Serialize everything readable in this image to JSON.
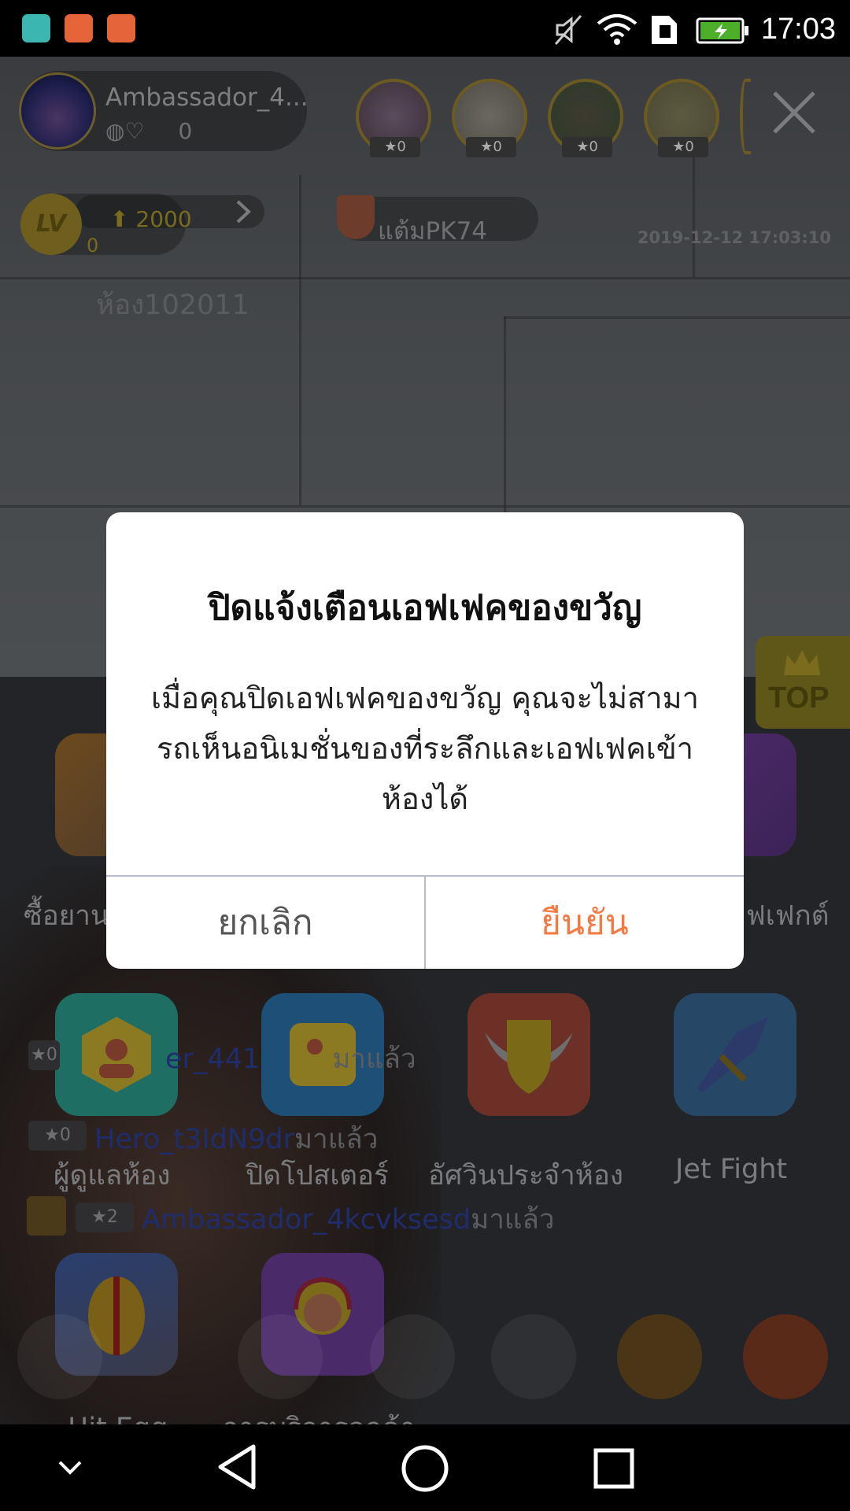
{
  "status_bar": {
    "time": "17:03",
    "icons": [
      "android-icon",
      "music-icon",
      "music-icon",
      "mute-icon",
      "wifi-icon",
      "sim-icon",
      "battery-charging-icon"
    ]
  },
  "header": {
    "host_name": "Ambassador_4...",
    "host_likes": "0",
    "viewers": [
      {
        "stars": "0"
      },
      {
        "stars": "0"
      },
      {
        "stars": "0"
      },
      {
        "stars": "0"
      }
    ],
    "close_icon": "close-icon"
  },
  "level": {
    "badge": "LV",
    "points": "2000",
    "sub": "0"
  },
  "pk": {
    "label": "แต้มPK74"
  },
  "timestamp": "2019-12-12 17:03:10",
  "room_id": "ห้อง102011",
  "top_button": {
    "label": "TOP"
  },
  "grid": {
    "row1_labels": {
      "left": "ซื้อยาน",
      "right": "ฟเฟกต์"
    },
    "row2": [
      {
        "label": "ผู้ดูแลห้อง"
      },
      {
        "label": "ปิดโปสเตอร์"
      },
      {
        "label": "อัศวินประจำห้อง"
      },
      {
        "label": "Jet Fight"
      }
    ],
    "row3": [
      {
        "label": "Hit Egg"
      },
      {
        "label": "การบริการลูกค้า"
      }
    ]
  },
  "chat": [
    {
      "star": "0",
      "name": "er_441",
      "suffix": "มาแล้ว"
    },
    {
      "star": "0",
      "name": "Hero_t3IdN9dr",
      "suffix": "มาแล้ว"
    },
    {
      "star": "2",
      "name": "Ambassador_4kcvksesd",
      "suffix": "มาแล้ว"
    }
  ],
  "dialog": {
    "title": "ปิดแจ้งเตือนเอฟเฟคของขวัญ",
    "message": "เมื่อคุณปิดเอฟเฟคของขวัญ คุณจะไม่สามารถเห็นอนิเมชั่นของที่ระลึกและเอฟเฟคเข้าห้องได้",
    "cancel": "ยกเลิก",
    "confirm": "ยืนยัน",
    "confirm_color": "#f47a43"
  },
  "nav_bar": {
    "icons": [
      "chevron-down-icon",
      "back-icon",
      "home-icon",
      "recents-icon"
    ]
  }
}
